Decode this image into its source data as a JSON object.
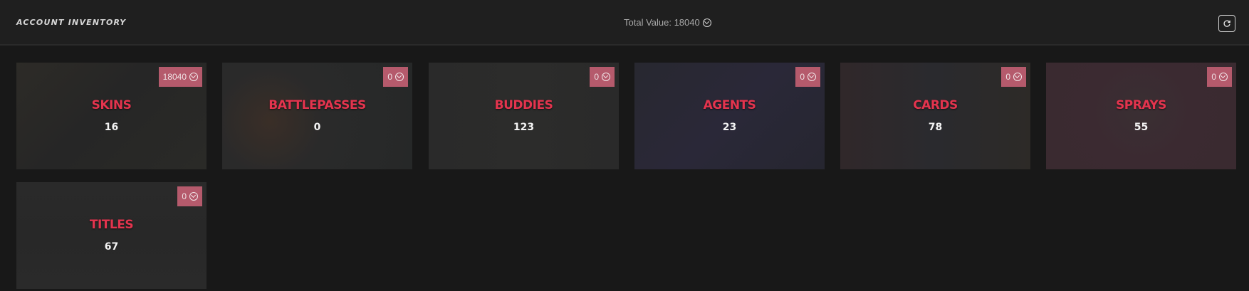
{
  "header": {
    "title": "ACCOUNT INVENTORY",
    "total_value_label": "Total Value: 18040",
    "currency_icon": "vp-currency-icon",
    "refresh_icon": "refresh-icon"
  },
  "colors": {
    "background": "#181818",
    "header": "#1f1f1f",
    "card_title": "#e4344e",
    "badge": "#b55a6c"
  },
  "cards": [
    {
      "name": "SKINS",
      "count": "16",
      "value": "18040"
    },
    {
      "name": "BATTLEPASSES",
      "count": "0",
      "value": "0"
    },
    {
      "name": "BUDDIES",
      "count": "123",
      "value": "0"
    },
    {
      "name": "AGENTS",
      "count": "23",
      "value": "0"
    },
    {
      "name": "CARDS",
      "count": "78",
      "value": "0"
    },
    {
      "name": "SPRAYS",
      "count": "55",
      "value": "0"
    },
    {
      "name": "TITLES",
      "count": "67",
      "value": "0"
    }
  ]
}
